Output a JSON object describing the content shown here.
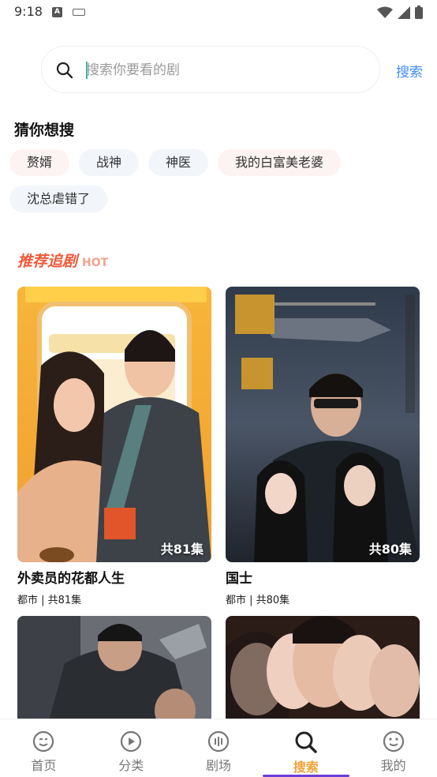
{
  "status_bar": {
    "time": "9:18",
    "a_icon_letter": "A"
  },
  "search": {
    "placeholder": "搜索你要看的剧",
    "button_label": "搜索"
  },
  "suggestions": {
    "title": "猜你想搜",
    "tags": [
      {
        "label": "赘婿",
        "style": "pink"
      },
      {
        "label": "战神",
        "style": "blue"
      },
      {
        "label": "神医",
        "style": "blue"
      },
      {
        "label": "我的白富美老婆",
        "style": "pink"
      },
      {
        "label": "沈总虐错了",
        "style": "blue"
      }
    ]
  },
  "recommend": {
    "title": "推荐追剧",
    "hot_label": "HOT",
    "items": [
      {
        "name": "外卖员的花都人生",
        "meta": "都市 | 共81集",
        "badge": "共81集"
      },
      {
        "name": "国士",
        "meta": "都市 | 共80集",
        "badge": "共80集"
      }
    ]
  },
  "bottom_nav": {
    "items": [
      {
        "label": "首页",
        "icon": "home-face-icon"
      },
      {
        "label": "分类",
        "icon": "play-circle-icon"
      },
      {
        "label": "剧场",
        "icon": "theater-bars-icon"
      },
      {
        "label": "搜索",
        "icon": "search-icon"
      },
      {
        "label": "我的",
        "icon": "profile-face-icon"
      }
    ],
    "active_label": "搜索"
  },
  "colors": {
    "accent": "#3f8cff",
    "hot": "#f05a3a",
    "nav_active": "#f0a33a",
    "underline": "#6a3fd8"
  }
}
